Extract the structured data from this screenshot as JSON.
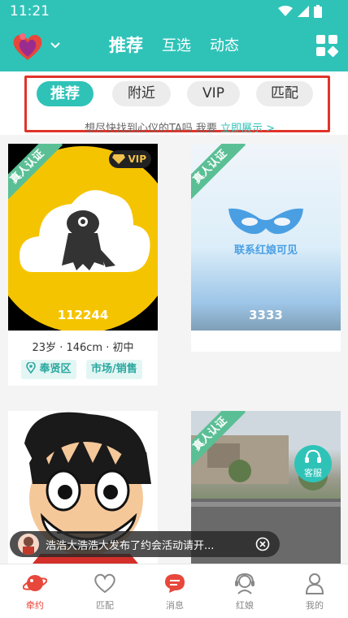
{
  "status_bar": {
    "time": "11:21"
  },
  "nav": {
    "tabs": [
      {
        "label": "推荐",
        "active": true
      },
      {
        "label": "互选",
        "active": false
      },
      {
        "label": "动态",
        "active": false
      }
    ]
  },
  "filter": {
    "chips": [
      {
        "label": "推荐",
        "active": true
      },
      {
        "label": "附近",
        "active": false
      },
      {
        "label": "VIP",
        "active": false
      },
      {
        "label": "匹配",
        "active": false
      }
    ],
    "hint_text": "想尽快找到心仪的TA吗 我要 ",
    "hint_link": "立即展示 >"
  },
  "cards": [
    {
      "ribbon": "真人认证",
      "vip": "VIP",
      "id": "112244",
      "meta": "23岁 · 146cm · 初中",
      "tags": [
        "奉贤区",
        "市场/销售"
      ]
    },
    {
      "ribbon": "真人认证",
      "overlay_text": "联系红娘可见",
      "id": "3333"
    },
    {
      "ribbon": ""
    },
    {
      "ribbon": "真人认证"
    }
  ],
  "kefu": {
    "label": "客服"
  },
  "notice": {
    "text": "浩浩大浩浩大发布了约会活动请开..."
  },
  "bottom_nav": [
    {
      "label": "牵约",
      "icon": "planet-icon",
      "active": true
    },
    {
      "label": "匹配",
      "icon": "heart-icon",
      "active": false
    },
    {
      "label": "消息",
      "icon": "message-icon",
      "active": false
    },
    {
      "label": "红娘",
      "icon": "headset-icon",
      "active": false
    },
    {
      "label": "我的",
      "icon": "person-icon",
      "active": false
    }
  ],
  "colors": {
    "primary": "#2fc3b8",
    "accent_red": "#e8473b",
    "highlight_border": "#e0342a",
    "ribbon_green": "#5bbf95"
  }
}
